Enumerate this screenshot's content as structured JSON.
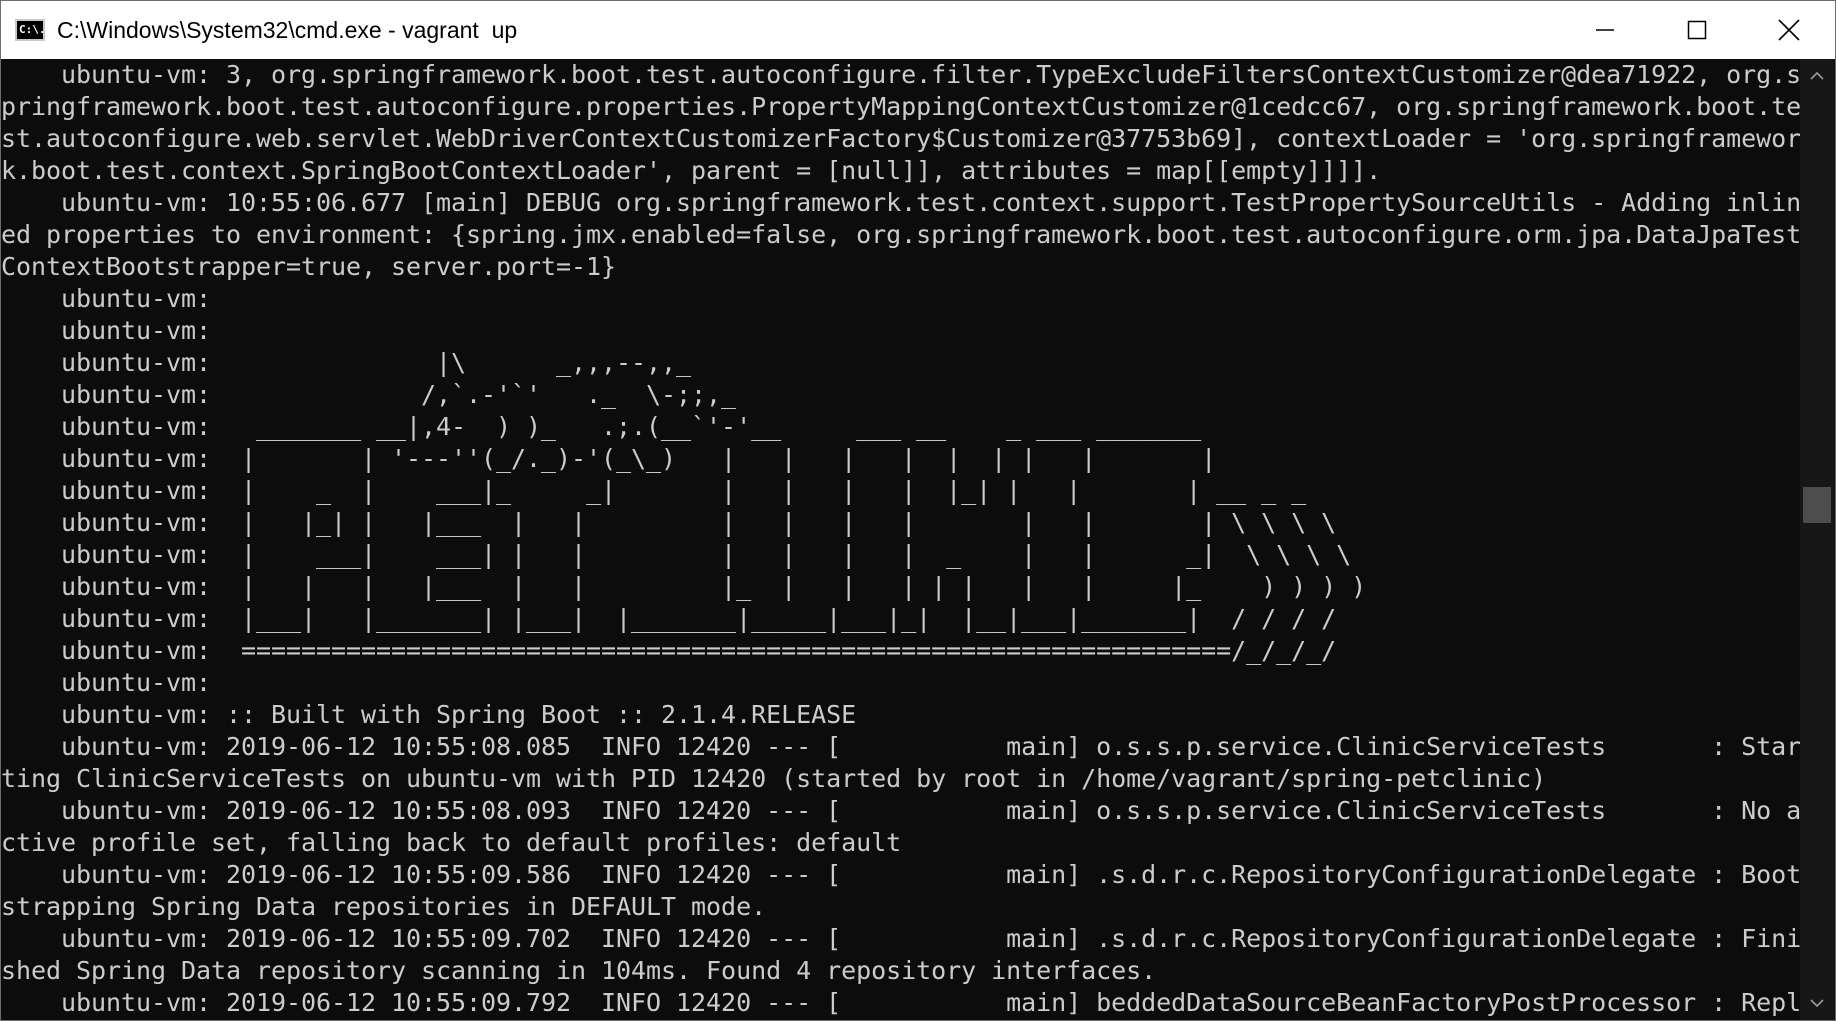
{
  "window": {
    "title": "C:\\Windows\\System32\\cmd.exe - vagrant  up",
    "app_icon_text": "C:\\."
  },
  "controls": {
    "minimize": "minimize-icon",
    "maximize": "maximize-icon",
    "close": "close-icon"
  },
  "console": {
    "lines": [
      "    ubuntu-vm: 3, org.springframework.boot.test.autoconfigure.filter.TypeExcludeFiltersContextCustomizer@dea71922, org.s",
      "pringframework.boot.test.autoconfigure.properties.PropertyMappingContextCustomizer@1cedcc67, org.springframework.boot.te",
      "st.autoconfigure.web.servlet.WebDriverContextCustomizerFactory$Customizer@37753b69], contextLoader = 'org.springframewor",
      "k.boot.test.context.SpringBootContextLoader', parent = [null]], attributes = map[[empty]]]].",
      "    ubuntu-vm: 10:55:06.677 [main] DEBUG org.springframework.test.context.support.TestPropertySourceUtils - Adding inlin",
      "ed properties to environment: {spring.jmx.enabled=false, org.springframework.boot.test.autoconfigure.orm.jpa.DataJpaTest",
      "ContextBootstrapper=true, server.port=-1}",
      "    ubuntu-vm:",
      "    ubuntu-vm:",
      "    ubuntu-vm:               |\\      _,,,--,,_",
      "    ubuntu-vm:              /,`.-'`'   ._  \\-;;,_",
      "    ubuntu-vm:   _______ __|,4-  ) )_   .;.(__`'-'__     ___ __    _ ___ _______",
      "    ubuntu-vm:  |       | '---''(_/._)-'(_\\_)   |   |   |   |  |  | |   |       |",
      "    ubuntu-vm:  |    _  |    ___|_     _|       |   |   |   |  |_| |   |       | __ _ _",
      "    ubuntu-vm:  |   |_| |   |___  |   |         |   |   |   |       |   |       | \\ \\ \\ \\",
      "    ubuntu-vm:  |    ___|    ___| |   |         |   |   |   |  _    |   |      _|  \\ \\ \\ \\",
      "    ubuntu-vm:  |   |   |   |___  |   |         |_  |   |   | | |   |   |     |_    ) ) ) )",
      "    ubuntu-vm:  |___|   |_______| |___|  |_______|_____|___|_|  |__|___|_______|  / / / /",
      "    ubuntu-vm:  ==================================================================/_/_/_/",
      "    ubuntu-vm:",
      "    ubuntu-vm: :: Built with Spring Boot :: 2.1.4.RELEASE",
      "    ubuntu-vm: 2019-06-12 10:55:08.085  INFO 12420 --- [           main] o.s.s.p.service.ClinicServiceTests       : Star",
      "ting ClinicServiceTests on ubuntu-vm with PID 12420 (started by root in /home/vagrant/spring-petclinic)",
      "    ubuntu-vm: 2019-06-12 10:55:08.093  INFO 12420 --- [           main] o.s.s.p.service.ClinicServiceTests       : No a",
      "ctive profile set, falling back to default profiles: default",
      "    ubuntu-vm: 2019-06-12 10:55:09.586  INFO 12420 --- [           main] .s.d.r.c.RepositoryConfigurationDelegate : Boot",
      "strapping Spring Data repositories in DEFAULT mode.",
      "    ubuntu-vm: 2019-06-12 10:55:09.702  INFO 12420 --- [           main] .s.d.r.c.RepositoryConfigurationDelegate : Fini",
      "shed Spring Data repository scanning in 104ms. Found 4 repository interfaces.",
      "    ubuntu-vm: 2019-06-12 10:55:09.792  INFO 12420 --- [           main] beddedDataSourceBeanFactoryPostProcessor : Repl"
    ]
  },
  "scrollbar": {
    "position_fraction": 0.46
  }
}
